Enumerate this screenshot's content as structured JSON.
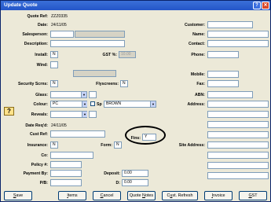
{
  "window": {
    "title": "Update Quote",
    "help_glyph": "?",
    "close_glyph": "✕"
  },
  "labels": {
    "quote_ref": "Quote Ref:",
    "date": "Date:",
    "salesperson": "Salesperson:",
    "description": "Description:",
    "install": "Install:",
    "gst": "GST %:",
    "wind": "Wind:",
    "security_scrns": "Security Scrns:",
    "flyscreens": "Flyscreens:",
    "glass": "Glass:",
    "colour": "Colour:",
    "sp": "Sp",
    "reveals": "Reveals:",
    "fins": "Fins:",
    "date_reqd": "Date Req'd:",
    "cust_ref": "Cust Ref:",
    "insurance": "Insurance:",
    "form": "Form:",
    "co": "Co:",
    "policy": "Policy #:",
    "payment_by": "Payment By:",
    "deposit": "Deposit:",
    "pb": "P/B:",
    "d": "D:",
    "customer": "Customer:",
    "name": "Name:",
    "contact": "Contact:",
    "phone": "Phone:",
    "mobile": "Mobile:",
    "fax": "Fax:",
    "abn": "ABN:",
    "address": "Address:",
    "site_address": "Site Address:"
  },
  "values": {
    "quote_ref": "ZZZ0335",
    "date": "24/11/05",
    "install": "N",
    "gst": "10.00",
    "security_scrns": "N",
    "flyscreens": "N",
    "colour": "PC",
    "colour_sp": "BROWN",
    "fins": "Y",
    "date_reqd": "24/11/05",
    "insurance": "N",
    "form": "N",
    "deposit": "0.00",
    "d": "0.00"
  },
  "icons": {
    "warning_glyph": "?"
  },
  "buttons": {
    "save_u": "S",
    "save_rest": "ave",
    "items_u": "I",
    "items_rest": "tems",
    "cancel_u": "C",
    "cancel_rest": "ancel",
    "quote_notes_a": "Quote ",
    "quote_notes_u": "N",
    "quote_notes_b": "otes",
    "cust_refresh_a": "C",
    "cust_refresh_u": "u",
    "cust_refresh_b": "st. Refresh",
    "invoice_u": "I",
    "invoice_rest": "nvoice",
    "gst_u": "G",
    "gst_rest": "ST"
  }
}
